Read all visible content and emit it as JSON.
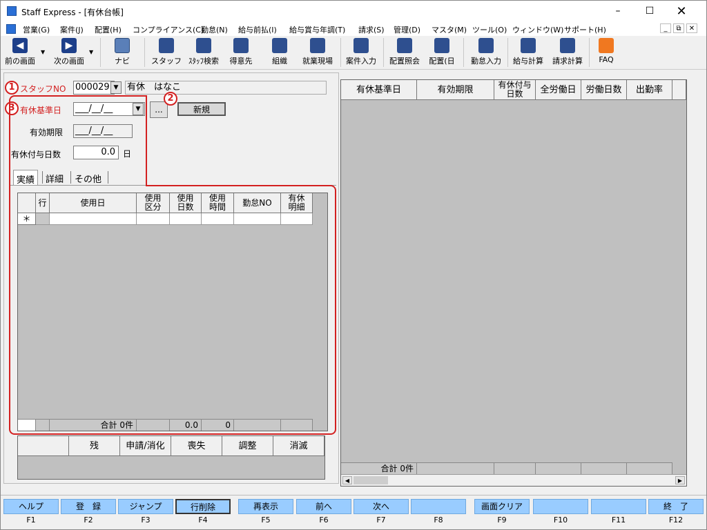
{
  "window": {
    "title": "Staff Express - [有休台帳]"
  },
  "menu": [
    "営業(G)",
    "案件(J)",
    "配置(H)",
    "コンプライアンス(C)",
    "勤怠(N)",
    "給与前払(I)",
    "給与賞与年調(T)",
    "請求(S)",
    "管理(D)",
    "マスタ(M)",
    "ツール(O)",
    "ウィンドウ(W)",
    "サポート(H)"
  ],
  "toolbar": {
    "back": "前の画面",
    "forward": "次の画面",
    "navi": "ナビ",
    "staff": "スタッフ",
    "staff_search": "ｽﾀｯﾌ検索",
    "customer": "得意先",
    "org": "組織",
    "worksite": "就業現場",
    "case_entry": "案件入力",
    "assign_inquiry": "配置照会",
    "assign_day": "配置(日",
    "attendance": "勤怠入力",
    "pay_calc": "給与計算",
    "bill_calc": "請求計算",
    "faq": "FAQ"
  },
  "form": {
    "staff_no_label": "スタッフNO",
    "staff_no": "000029",
    "staff_name": "有休　はなこ",
    "base_date_label": "有休基準日",
    "base_date": "___/__/__",
    "expiry_label": "有効期限",
    "expiry": "___/__/__",
    "grant_days_label": "有休付与日数",
    "grant_days": "0.0",
    "grant_days_unit": "日",
    "ellipsis": "...",
    "new_button": "新規"
  },
  "markers": {
    "m1": "1",
    "m2": "2",
    "m3": "3"
  },
  "tabs": [
    "実績",
    "詳細",
    "その他"
  ],
  "usage_grid": {
    "headers": [
      "行",
      "使用日",
      "使用\n区分",
      "使用\n日数",
      "使用\n時間",
      "勤怠NO",
      "有休\n明細"
    ],
    "new_row_marker": "＊",
    "footer": {
      "total": "合計 0件",
      "days": "0.0",
      "time": "0"
    }
  },
  "summary_headers": [
    "残",
    "申請/消化",
    "喪失",
    "調整",
    "消滅"
  ],
  "right_grid": {
    "headers": [
      "有休基準日",
      "有効期限",
      "有休付与\n日数",
      "全労働日",
      "労働日数",
      "出勤率"
    ],
    "footer_total": "合計 0件"
  },
  "fkeys": [
    {
      "label": "ヘルプ",
      "key": "F1"
    },
    {
      "label": "登　録",
      "key": "F2"
    },
    {
      "label": "ジャンプ",
      "key": "F3"
    },
    {
      "label": "行削除",
      "key": "F4"
    },
    {
      "label": "再表示",
      "key": "F5"
    },
    {
      "label": "前へ",
      "key": "F6"
    },
    {
      "label": "次へ",
      "key": "F7"
    },
    {
      "label": "",
      "key": "F8"
    },
    {
      "label": "画面クリア",
      "key": "F9"
    },
    {
      "label": "",
      "key": "F10"
    },
    {
      "label": "",
      "key": "F11"
    },
    {
      "label": "終　了",
      "key": "F12"
    }
  ],
  "colors": {
    "accent_red": "#d32020",
    "fkey_blue": "#99ccff"
  }
}
